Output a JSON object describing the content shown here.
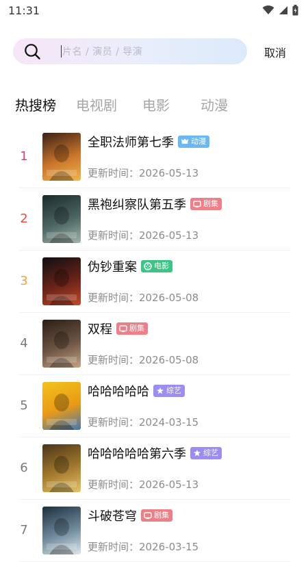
{
  "status_bar": {
    "time": "11:31"
  },
  "search": {
    "placeholder": "片名 / 演员 / 导演",
    "cancel_label": "取消"
  },
  "tabs": [
    {
      "label": "热搜榜",
      "active": true
    },
    {
      "label": "电视剧",
      "active": false
    },
    {
      "label": "电影",
      "active": false
    },
    {
      "label": "动漫",
      "active": false
    }
  ],
  "update_prefix": "更新时间：",
  "colors": {
    "rank_1": "#e8397a",
    "rank_2": "#ee4b3b",
    "rank_3": "#f2a33b",
    "rank_other": "#7a7a7a",
    "badge_anime": "#6bb8f2",
    "badge_series": "#ee7f87",
    "badge_movie": "#3dc486",
    "badge_variety": "#9b8ef0"
  },
  "items": [
    {
      "rank": "1",
      "title": "全职法师第七季",
      "badge": "动漫",
      "badge_type": "anime",
      "update_date": "2026-05-13",
      "poster_colors": [
        "#3a2117",
        "#c9752a",
        "#f0b64c"
      ]
    },
    {
      "rank": "2",
      "title": "黑袍纠察队第五季",
      "badge": "剧集",
      "badge_type": "series",
      "update_date": "2026-05-13",
      "poster_colors": [
        "#1b2a2c",
        "#4b6563",
        "#a3b4a7"
      ]
    },
    {
      "rank": "3",
      "title": "伪钞重案",
      "badge": "电影",
      "badge_type": "movie",
      "update_date": "2026-05-08",
      "poster_colors": [
        "#0f0f12",
        "#6b2219",
        "#c04a2a"
      ]
    },
    {
      "rank": "4",
      "title": "双程",
      "badge": "剧集",
      "badge_type": "series",
      "update_date": "2026-05-08",
      "poster_colors": [
        "#2a1e16",
        "#6d5544",
        "#c2a386"
      ]
    },
    {
      "rank": "5",
      "title": "哈哈哈哈哈",
      "badge": "综艺",
      "badge_type": "variety",
      "update_date": "2024-03-15",
      "poster_colors": [
        "#f4c21c",
        "#e89a17",
        "#3f78b5"
      ]
    },
    {
      "rank": "6",
      "title": "哈哈哈哈哈第六季",
      "badge": "综艺",
      "badge_type": "variety",
      "update_date": "2026-05-13",
      "poster_colors": [
        "#4a3318",
        "#a57a2e",
        "#e4c46b"
      ]
    },
    {
      "rank": "7",
      "title": "斗破苍穹",
      "badge": "剧集",
      "badge_type": "series",
      "update_date": "2026-03-15",
      "poster_colors": [
        "#1d2f3d",
        "#6f8a9c",
        "#dfe6ea"
      ]
    }
  ]
}
